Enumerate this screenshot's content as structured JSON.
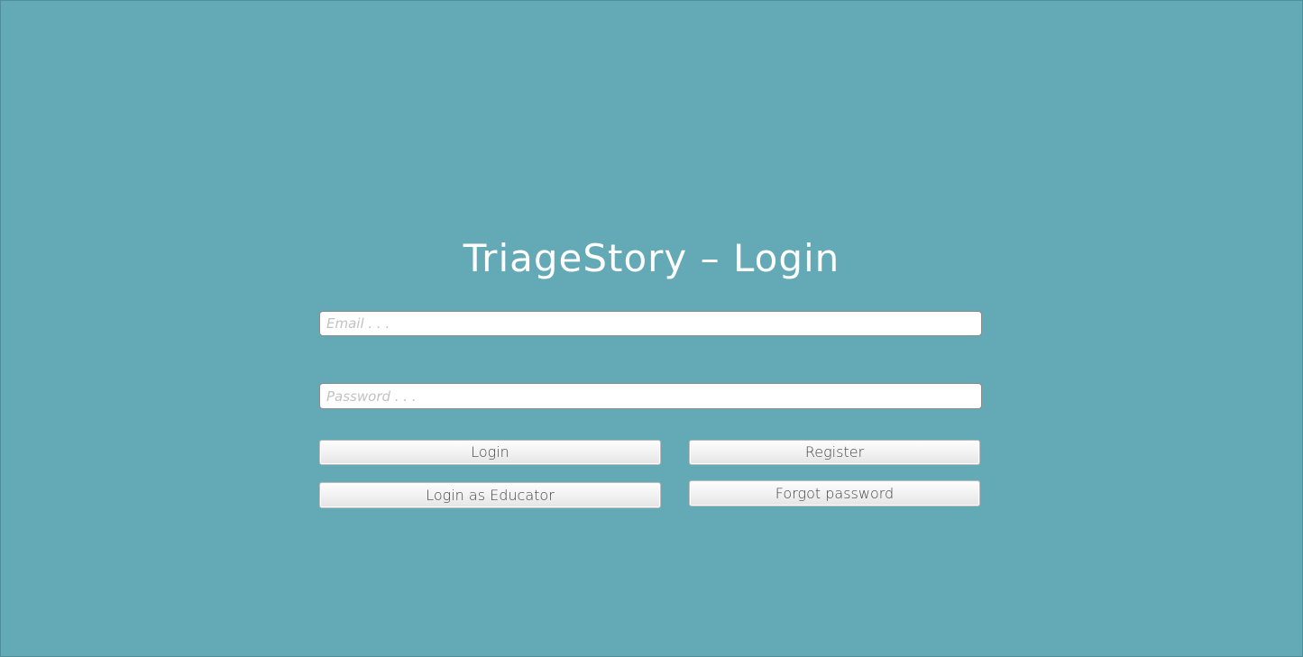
{
  "title": "TriageStory – Login",
  "email": {
    "placeholder": "Email . . ."
  },
  "password": {
    "placeholder": "Password . . ."
  },
  "buttons": {
    "login": "Login",
    "register": "Register",
    "login_educator": "Login as Educator",
    "forgot_password": "Forgot password"
  },
  "colors": {
    "background": "#64a9b6",
    "title": "#ffffff"
  }
}
